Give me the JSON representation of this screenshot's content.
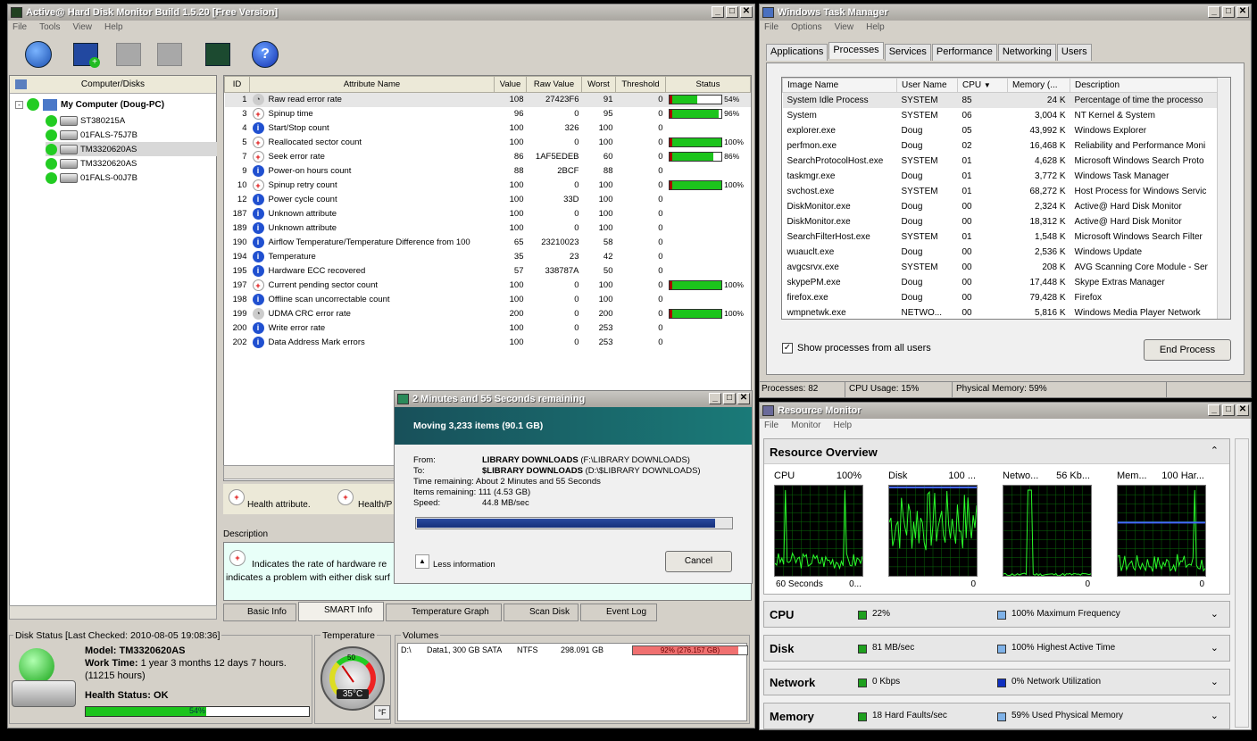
{
  "hdm": {
    "title": "Active@ Hard Disk Monitor Build 1.5.20 [Free Version]",
    "menu": [
      "File",
      "Tools",
      "View",
      "Help"
    ],
    "tree_header": "Computer/Disks",
    "tree_root": "My Computer (Doug-PC)",
    "tree_items": [
      "ST380215A",
      "01FALS-75J7B",
      "TM3320620AS",
      "TM3320620AS",
      "01FALS-00J7B"
    ],
    "columns": [
      "ID",
      "Attribute Name",
      "Value",
      "Raw Value",
      "Worst",
      "Threshold",
      "Status"
    ],
    "rows": [
      {
        "id": "1",
        "name": "Raw read error rate",
        "value": "108",
        "raw": "27423F6",
        "worst": "91",
        "thr": "0",
        "pct": "54%",
        "p": 54,
        "icon": "gray"
      },
      {
        "id": "3",
        "name": "Spinup time",
        "value": "96",
        "raw": "0",
        "worst": "95",
        "thr": "0",
        "pct": "96%",
        "p": 96,
        "icon": "red"
      },
      {
        "id": "4",
        "name": "Start/Stop count",
        "value": "100",
        "raw": "326",
        "worst": "100",
        "thr": "0",
        "pct": "",
        "p": null,
        "icon": "info"
      },
      {
        "id": "5",
        "name": "Reallocated sector count",
        "value": "100",
        "raw": "0",
        "worst": "100",
        "thr": "0",
        "pct": "100%",
        "p": 100,
        "icon": "red"
      },
      {
        "id": "7",
        "name": "Seek error rate",
        "value": "86",
        "raw": "1AF5EDEB",
        "worst": "60",
        "thr": "0",
        "pct": "86%",
        "p": 86,
        "icon": "red"
      },
      {
        "id": "9",
        "name": "Power-on hours count",
        "value": "88",
        "raw": "2BCF",
        "worst": "88",
        "thr": "0",
        "pct": "",
        "p": null,
        "icon": "info"
      },
      {
        "id": "10",
        "name": "Spinup retry count",
        "value": "100",
        "raw": "0",
        "worst": "100",
        "thr": "0",
        "pct": "100%",
        "p": 100,
        "icon": "red"
      },
      {
        "id": "12",
        "name": "Power cycle count",
        "value": "100",
        "raw": "33D",
        "worst": "100",
        "thr": "0",
        "pct": "",
        "p": null,
        "icon": "info"
      },
      {
        "id": "187",
        "name": "Unknown attribute",
        "value": "100",
        "raw": "0",
        "worst": "100",
        "thr": "0",
        "pct": "",
        "p": null,
        "icon": "info"
      },
      {
        "id": "189",
        "name": "Unknown attribute",
        "value": "100",
        "raw": "0",
        "worst": "100",
        "thr": "0",
        "pct": "",
        "p": null,
        "icon": "info"
      },
      {
        "id": "190",
        "name": "Airflow Temperature/Temperature Difference from 100",
        "value": "65",
        "raw": "23210023",
        "worst": "58",
        "thr": "0",
        "pct": "",
        "p": null,
        "icon": "info"
      },
      {
        "id": "194",
        "name": "Temperature",
        "value": "35",
        "raw": "23",
        "worst": "42",
        "thr": "0",
        "pct": "",
        "p": null,
        "icon": "info"
      },
      {
        "id": "195",
        "name": "Hardware ECC recovered",
        "value": "57",
        "raw": "338787A",
        "worst": "50",
        "thr": "0",
        "pct": "",
        "p": null,
        "icon": "info"
      },
      {
        "id": "197",
        "name": "Current pending sector count",
        "value": "100",
        "raw": "0",
        "worst": "100",
        "thr": "0",
        "pct": "100%",
        "p": 100,
        "icon": "red"
      },
      {
        "id": "198",
        "name": "Offline scan uncorrectable count",
        "value": "100",
        "raw": "0",
        "worst": "100",
        "thr": "0",
        "pct": "",
        "p": null,
        "icon": "info"
      },
      {
        "id": "199",
        "name": "UDMA CRC error rate",
        "value": "200",
        "raw": "0",
        "worst": "200",
        "thr": "0",
        "pct": "100%",
        "p": 100,
        "icon": "gray"
      },
      {
        "id": "200",
        "name": "Write error rate",
        "value": "100",
        "raw": "0",
        "worst": "253",
        "thr": "0",
        "pct": "",
        "p": null,
        "icon": "info"
      },
      {
        "id": "202",
        "name": "Data Address Mark errors",
        "value": "100",
        "raw": "0",
        "worst": "253",
        "thr": "0",
        "pct": "",
        "p": null,
        "icon": "info"
      }
    ],
    "legend_health": "Health attribute.",
    "legend_health2": "Health/P",
    "desc_label": "Description",
    "desc_text1": "Indicates the rate of hardware re",
    "desc_text2": "indicates a problem with either disk surf",
    "tabs": [
      "Basic Info",
      "SMART Info",
      "Temperature Graph",
      "Scan Disk",
      "Event Log"
    ],
    "status_label": "Disk Status [Last Checked: 2010-08-05 19:08:36]",
    "model_label": "Model:",
    "model": "TM3320620AS",
    "worktime_label": "Work Time:",
    "worktime": "1 year 3 months 12 days 7 hours.",
    "worktime_hours": "(11215 hours)",
    "health_status": "Health Status: OK",
    "health_pct": "54%",
    "health_fill": 54,
    "temp_label": "Temperature",
    "gauge_50": "50",
    "temp_value": "35°C",
    "temp_unit": "°F",
    "volumes_label": "Volumes",
    "vol_drive": "D:\\",
    "vol_desc": "Data1,  300 GB SATA",
    "vol_fs": "NTFS",
    "vol_size": "298.091 GB",
    "vol_used": "92% (276.157 GB)",
    "vol_fill": 92
  },
  "copy": {
    "title": "2 Minutes and 55 Seconds remaining",
    "heading": "Moving 3,233 items (90.1 GB)",
    "from_label": "From:",
    "from_bold": "LIBRARY DOWNLOADS",
    "from_path": "(F:\\LIBRARY DOWNLOADS)",
    "to_label": "To:",
    "to_bold": "$LIBRARY DOWNLOADS",
    "to_path": "(D:\\$LIBRARY DOWNLOADS)",
    "time_label": "Time remaining:",
    "time_value": "About 2 Minutes and 55 Seconds",
    "items_label": "Items remaining:",
    "items_value": "111 (4.53 GB)",
    "speed_label": "Speed:",
    "speed_value": "44.8 MB/sec",
    "progress": 95,
    "less_info": "Less information",
    "cancel": "Cancel"
  },
  "taskmgr": {
    "title": "Windows Task Manager",
    "menu": [
      "File",
      "Options",
      "View",
      "Help"
    ],
    "tabs": [
      "Applications",
      "Processes",
      "Services",
      "Performance",
      "Networking",
      "Users"
    ],
    "columns": [
      "Image Name",
      "User Name",
      "CPU",
      "Memory (...",
      "Description"
    ],
    "rows": [
      [
        "System Idle Process",
        "SYSTEM",
        "85",
        "24 K",
        "Percentage of time the processo"
      ],
      [
        "System",
        "SYSTEM",
        "06",
        "3,004 K",
        "NT Kernel & System"
      ],
      [
        "explorer.exe",
        "Doug",
        "05",
        "43,992 K",
        "Windows Explorer"
      ],
      [
        "perfmon.exe",
        "Doug",
        "02",
        "16,468 K",
        "Reliability and Performance Moni"
      ],
      [
        "SearchProtocolHost.exe",
        "SYSTEM",
        "01",
        "4,628 K",
        "Microsoft Windows Search Proto"
      ],
      [
        "taskmgr.exe",
        "Doug",
        "01",
        "3,772 K",
        "Windows Task Manager"
      ],
      [
        "svchost.exe",
        "SYSTEM",
        "01",
        "68,272 K",
        "Host Process for Windows Servic"
      ],
      [
        "DiskMonitor.exe",
        "Doug",
        "00",
        "2,324 K",
        "Active@ Hard Disk Monitor"
      ],
      [
        "DiskMonitor.exe",
        "Doug",
        "00",
        "18,312 K",
        "Active@ Hard Disk Monitor"
      ],
      [
        "SearchFilterHost.exe",
        "SYSTEM",
        "01",
        "1,548 K",
        "Microsoft Windows Search Filter"
      ],
      [
        "wuauclt.exe",
        "Doug",
        "00",
        "2,536 K",
        "Windows Update"
      ],
      [
        "avgcsrvx.exe",
        "SYSTEM",
        "00",
        "208 K",
        "AVG Scanning Core Module - Ser"
      ],
      [
        "skypePM.exe",
        "Doug",
        "00",
        "17,448 K",
        "Skype Extras Manager"
      ],
      [
        "firefox.exe",
        "Doug",
        "00",
        "79,428 K",
        "Firefox"
      ],
      [
        "wmpnetwk.exe",
        "NETWO...",
        "00",
        "5,816 K",
        "Windows Media Player Network"
      ]
    ],
    "show_all": "Show processes from all users",
    "end_process": "End Process",
    "status_processes": "Processes: 82",
    "status_cpu": "CPU Usage: 15%",
    "status_mem": "Physical Memory: 59%"
  },
  "resmon": {
    "title": "Resource Monitor",
    "menu": [
      "File",
      "Monitor",
      "Help"
    ],
    "overview": "Resource Overview",
    "graphs": [
      {
        "name": "CPU",
        "max": "100%",
        "foot_l": "60 Seconds",
        "foot_r": "0..."
      },
      {
        "name": "Disk",
        "max": "100 ...",
        "foot_l": "",
        "foot_r": "0"
      },
      {
        "name": "Netwo...",
        "max": "56 Kb...",
        "foot_l": "",
        "foot_r": "0"
      },
      {
        "name": "Mem...",
        "max": "100 Har...",
        "foot_l": "",
        "foot_r": "0"
      }
    ],
    "sections": [
      {
        "name": "CPU",
        "v1": "22%",
        "v2": "100% Maximum Frequency",
        "c2": "#7fb2e8"
      },
      {
        "name": "Disk",
        "v1": "81 MB/sec",
        "v2": "100% Highest Active Time",
        "c2": "#7fb2e8"
      },
      {
        "name": "Network",
        "v1": "0 Kbps",
        "v2": "0% Network Utilization",
        "c2": "#1030c0"
      },
      {
        "name": "Memory",
        "v1": "18 Hard Faults/sec",
        "v2": "59% Used Physical Memory",
        "c2": "#7fb2e8"
      }
    ]
  }
}
